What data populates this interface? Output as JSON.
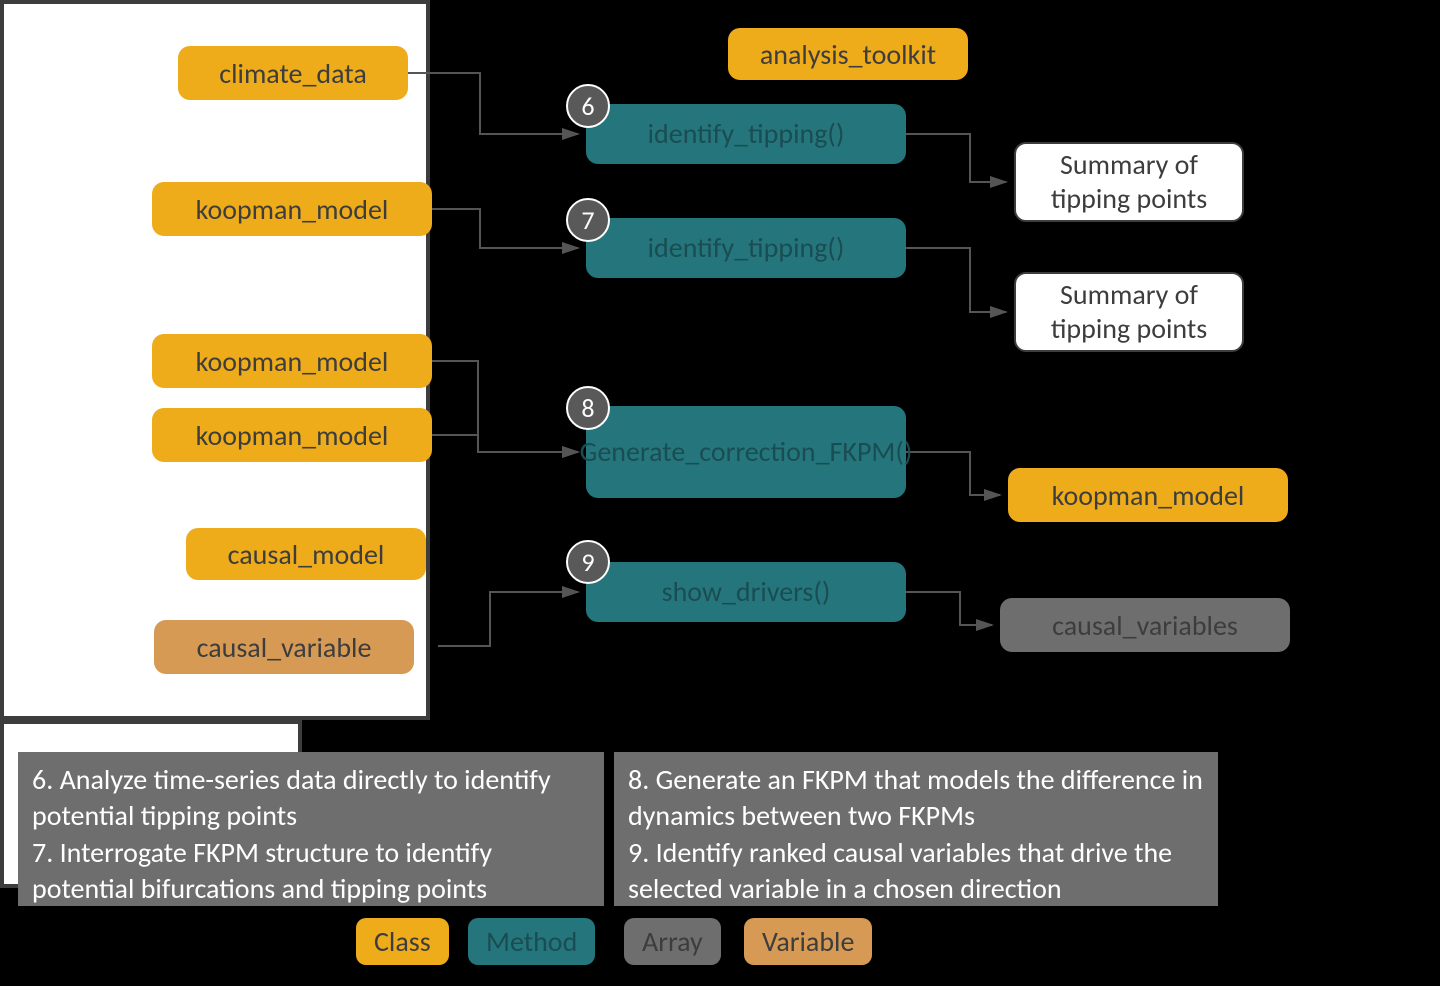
{
  "inputs": {
    "climate_data": "climate_data",
    "koopman_model_7": "koopman_model",
    "koopman_model_8a": "koopman_model",
    "koopman_model_8b": "koopman_model"
  },
  "causal": {
    "class_label": "causal_model",
    "variable_label": "causal_variable"
  },
  "toolkit": {
    "title": "analysis_toolkit",
    "methods": {
      "m6": "identify_tipping()",
      "m7": "identify_tipping()",
      "m8": "Generate_correction_FKPM()",
      "m9": "show_drivers()"
    },
    "badges": {
      "b6": "6",
      "b7": "7",
      "b8": "8",
      "b9": "9"
    }
  },
  "outputs": {
    "o6": "Summary of tipping points",
    "o7": "Summary of tipping points",
    "o8": "koopman_model",
    "o9": "causal_variables"
  },
  "descriptions": {
    "left": "6. Analyze time-series data directly to identify potential tipping points\n7. Interrogate FKPM structure to identify potential bifurcations and tipping points",
    "right": "8. Generate an FKPM that models the difference in dynamics between two FKPMs\n9. Identify ranked causal variables that drive the selected variable in a chosen direction"
  },
  "legend": {
    "class": "Class",
    "method": "Method",
    "array": "Array",
    "variable": "Variable"
  }
}
